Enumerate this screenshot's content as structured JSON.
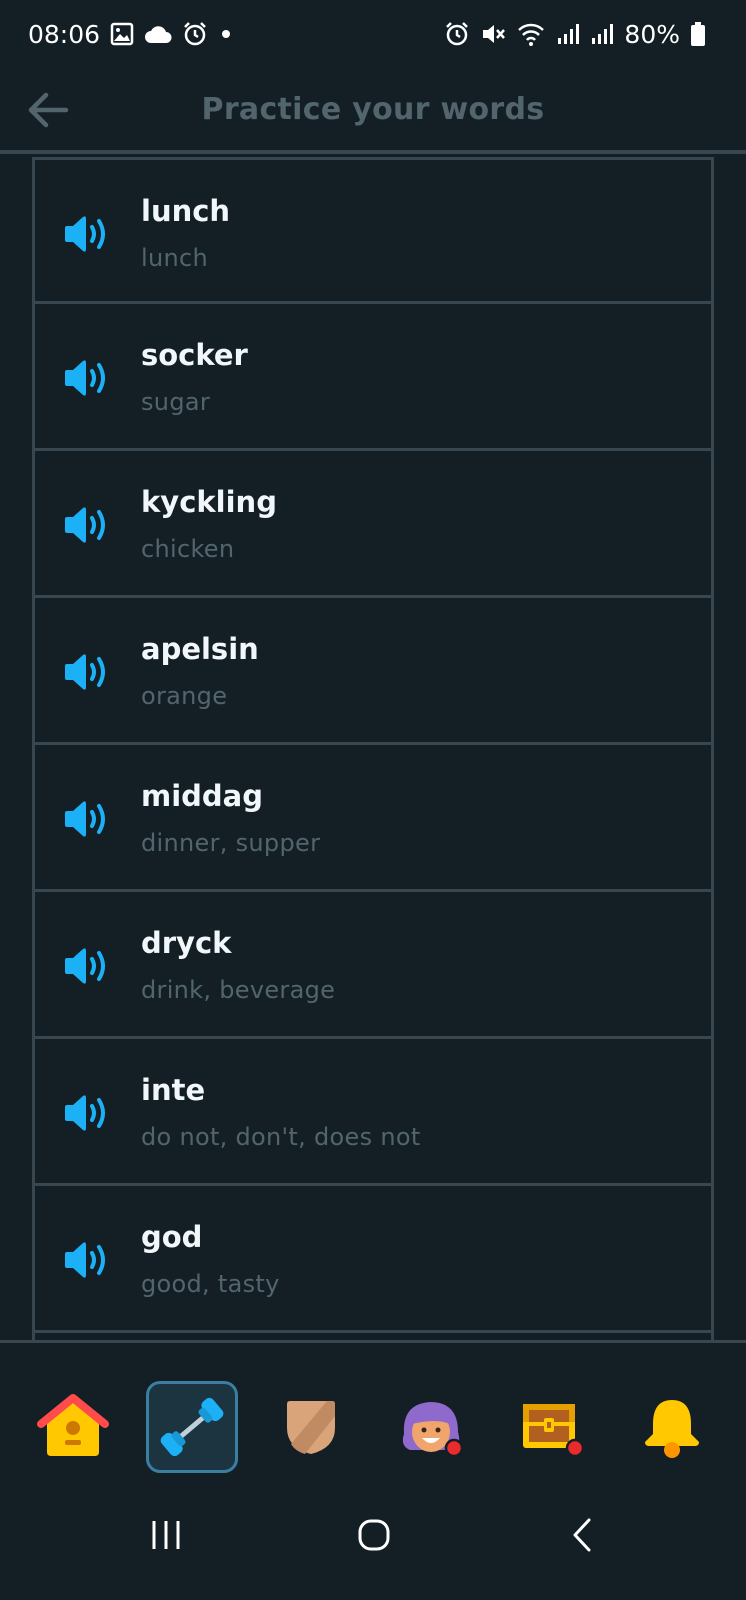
{
  "status_bar": {
    "time": "08:06",
    "battery": "80%",
    "left_icons": [
      "image-icon",
      "cloud-icon",
      "alarm-icon",
      "dot-icon"
    ],
    "right_icons": [
      "alarm-icon",
      "mute-icon",
      "wifi-icon",
      "signal-icon",
      "signal-icon",
      "battery-icon"
    ]
  },
  "header": {
    "title": "Practice your words",
    "back_icon": "arrow-left-icon"
  },
  "words": [
    {
      "word": "lunch",
      "translation": "lunch"
    },
    {
      "word": "socker",
      "translation": "sugar"
    },
    {
      "word": "kyckling",
      "translation": "chicken"
    },
    {
      "word": "apelsin",
      "translation": "orange"
    },
    {
      "word": "middag",
      "translation": "dinner, supper"
    },
    {
      "word": "dryck",
      "translation": "drink, beverage"
    },
    {
      "word": "inte",
      "translation": "do not, don't, does not"
    },
    {
      "word": "god",
      "translation": "good, tasty"
    }
  ],
  "tabs": [
    {
      "icon": "home-icon"
    },
    {
      "icon": "dumbbell-icon",
      "active": true
    },
    {
      "icon": "shield-icon"
    },
    {
      "icon": "character-avatar-icon"
    },
    {
      "icon": "treasure-chest-icon"
    },
    {
      "icon": "bell-icon"
    }
  ],
  "nav": [
    "recent-apps-icon",
    "home-circle-icon",
    "back-chevron-icon"
  ],
  "colors": {
    "background": "#141f25",
    "border": "#37464f",
    "speaker": "#1cb0f6",
    "muted_text": "#52656d",
    "active_tab_border": "#3a7ea3"
  }
}
